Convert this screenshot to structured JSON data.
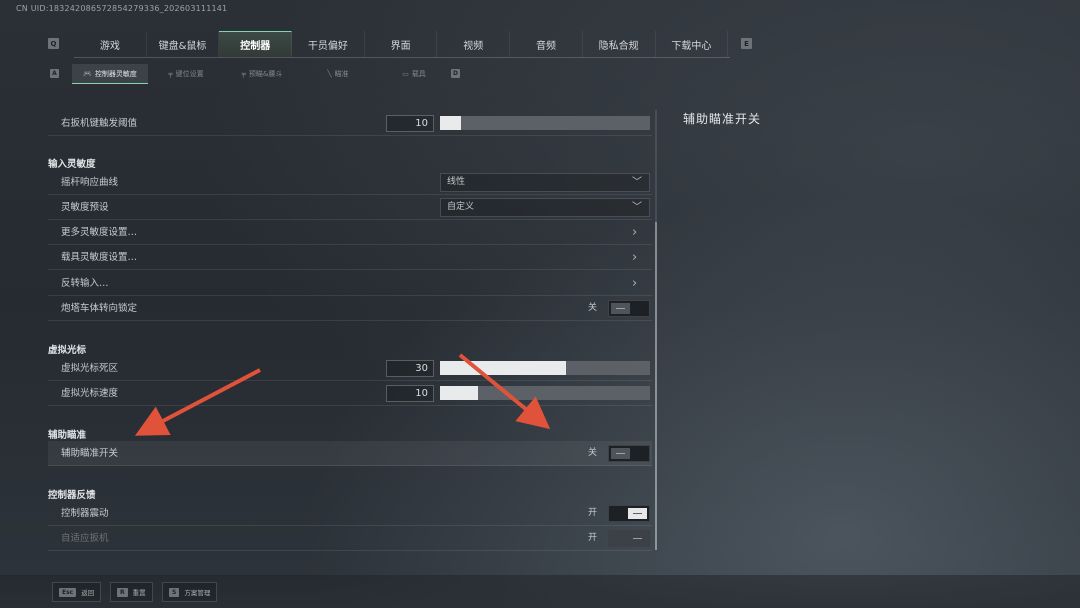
{
  "uid_text": "CN UID:18324208657285427933​6_202603111141",
  "colors": {
    "accent": "#7fd8a4",
    "annotation_arrow": "#e0533a"
  },
  "top_nav": {
    "key_left": "Q",
    "key_right": "E",
    "tabs": [
      {
        "label": "游戏"
      },
      {
        "label": "键盘&鼠标"
      },
      {
        "label": "控制器",
        "active": true
      },
      {
        "label": "干员偏好"
      },
      {
        "label": "界面"
      },
      {
        "label": "视频"
      },
      {
        "label": "音频"
      },
      {
        "label": "隐私合规"
      },
      {
        "label": "下载中心"
      }
    ]
  },
  "sub_nav": {
    "key_left": "A",
    "key_right": "D",
    "tabs": [
      {
        "label": "控制器灵敏度",
        "icon": "gamepad-icon",
        "active": true
      },
      {
        "label": "键位设置",
        "icon": "gun-icon"
      },
      {
        "label": "预瞄&腰斗",
        "icon": "gun-icon"
      },
      {
        "label": "瞄准",
        "icon": "knife-icon"
      },
      {
        "label": "载具",
        "icon": "vehicle-icon"
      }
    ]
  },
  "rows": {
    "trigger": {
      "label": "右扳机键触发阈值",
      "value": "10",
      "level": 0.1
    },
    "section_input": "输入灵敏度",
    "curve": {
      "label": "摇杆响应曲线",
      "value": "线性"
    },
    "preset": {
      "label": "灵敏度预设",
      "value": "自定义"
    },
    "more_sens": {
      "label": "更多灵敏度设置…"
    },
    "vehicle_sens": {
      "label": "载具灵敏度设置…"
    },
    "invert": {
      "label": "反转输入…"
    },
    "turret_lock": {
      "label": "炮塔车体转向锁定",
      "state": "关"
    },
    "section_cursor": "虚拟光标",
    "cursor_deadzone": {
      "label": "虚拟光标死区",
      "value": "30",
      "level": 0.6
    },
    "cursor_speed": {
      "label": "虚拟光标速度",
      "value": "10",
      "level": 0.18
    },
    "section_aim": "辅助瞄准",
    "aim_assist": {
      "label": "辅助瞄准开关",
      "state": "关"
    },
    "section_feedback": "控制器反馈",
    "vibration": {
      "label": "控制器震动",
      "state": "开"
    },
    "adaptive_trigger": {
      "label": "自适应扳机",
      "state": "开"
    }
  },
  "detail_panel": {
    "title": "辅助瞄准开关"
  },
  "bottom_bar": [
    {
      "key": "Esc",
      "label": "返回"
    },
    {
      "key": "R",
      "label": "重置"
    },
    {
      "key": "S",
      "label": "方案管理"
    }
  ]
}
